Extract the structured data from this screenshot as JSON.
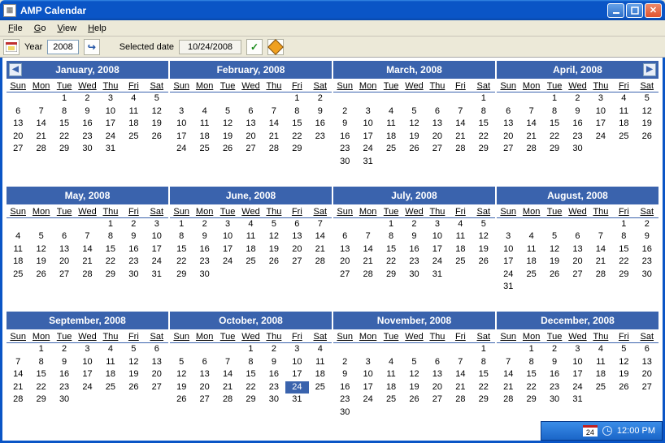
{
  "window": {
    "title": "AMP Calendar"
  },
  "menubar": {
    "file": "File",
    "go": "Go",
    "view": "View",
    "help": "Help"
  },
  "toolbar": {
    "year_label": "Year",
    "year_value": "2008",
    "selected_label": "Selected date",
    "selected_value": "10/24/2008"
  },
  "dow": [
    "Sun",
    "Mon",
    "Tue",
    "Wed",
    "Thu",
    "Fri",
    "Sat"
  ],
  "months": [
    {
      "title": "January, 2008",
      "start": 2,
      "count": 31
    },
    {
      "title": "February, 2008",
      "start": 5,
      "count": 29
    },
    {
      "title": "March, 2008",
      "start": 6,
      "count": 31
    },
    {
      "title": "April, 2008",
      "start": 2,
      "count": 30
    },
    {
      "title": "May, 2008",
      "start": 4,
      "count": 31
    },
    {
      "title": "June, 2008",
      "start": 0,
      "count": 30
    },
    {
      "title": "July, 2008",
      "start": 2,
      "count": 31
    },
    {
      "title": "August, 2008",
      "start": 5,
      "count": 31
    },
    {
      "title": "September, 2008",
      "start": 1,
      "count": 30
    },
    {
      "title": "October, 2008",
      "start": 3,
      "count": 31
    },
    {
      "title": "November, 2008",
      "start": 6,
      "count": 30
    },
    {
      "title": "December, 2008",
      "start": 1,
      "count": 31
    }
  ],
  "selected": {
    "monthIndex": 9,
    "day": 24
  },
  "tray": {
    "day": "24",
    "time": "12:00 PM"
  }
}
